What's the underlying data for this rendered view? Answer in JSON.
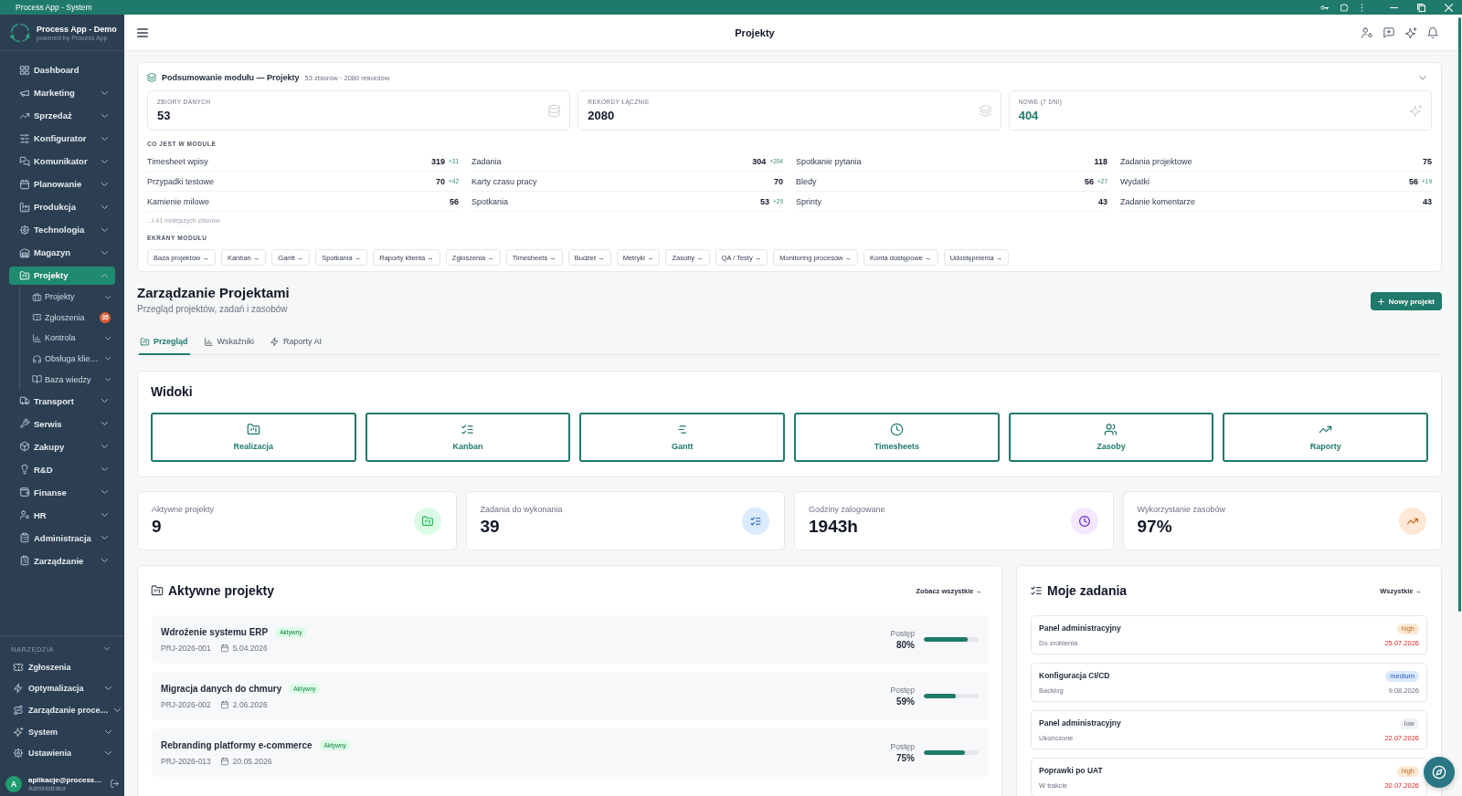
{
  "window": {
    "title": "Process App - System"
  },
  "sidebar": {
    "brand": {
      "name": "Process App - Demo",
      "tagline": "powered by Process App"
    },
    "items": [
      {
        "label": "Dashboard",
        "kind": "link",
        "selected": false
      },
      {
        "label": "Marketing",
        "kind": "group",
        "selected": false,
        "expanded": false
      },
      {
        "label": "Sprzedaż",
        "kind": "group",
        "selected": false,
        "expanded": false
      },
      {
        "label": "Konfigurator",
        "kind": "group",
        "selected": false,
        "expanded": false
      },
      {
        "label": "Komunikator",
        "kind": "group",
        "selected": false,
        "expanded": false
      },
      {
        "label": "Planowanie",
        "kind": "group",
        "selected": false,
        "expanded": false
      },
      {
        "label": "Produkcja",
        "kind": "group",
        "selected": false,
        "expanded": false
      },
      {
        "label": "Technologia",
        "kind": "group",
        "selected": false,
        "expanded": false
      },
      {
        "label": "Magazyn",
        "kind": "group",
        "selected": false,
        "expanded": false
      },
      {
        "label": "Projekty",
        "kind": "group",
        "selected": true,
        "expanded": true,
        "children": [
          {
            "label": "Projekty",
            "kind": "group",
            "selected": false,
            "expanded": false
          },
          {
            "label": "Zgłoszenia",
            "kind": "link",
            "selected": false,
            "badge": "35"
          },
          {
            "label": "Kontrola",
            "kind": "group",
            "selected": false,
            "expanded": false
          },
          {
            "label": "Obsługa klie…",
            "kind": "group",
            "selected": false,
            "expanded": false
          },
          {
            "label": "Baza wiedzy",
            "kind": "group",
            "selected": false,
            "expanded": false
          }
        ]
      },
      {
        "label": "Transport",
        "kind": "group",
        "selected": false,
        "expanded": false
      },
      {
        "label": "Serwis",
        "kind": "group",
        "selected": false,
        "expanded": false
      },
      {
        "label": "Zakupy",
        "kind": "group",
        "selected": false,
        "expanded": false
      },
      {
        "label": "R&D",
        "kind": "group",
        "selected": false,
        "expanded": false
      },
      {
        "label": "Finanse",
        "kind": "group",
        "selected": false,
        "expanded": false
      },
      {
        "label": "HR",
        "kind": "group",
        "selected": false,
        "expanded": false
      },
      {
        "label": "Administracja",
        "kind": "group",
        "selected": false,
        "expanded": false
      },
      {
        "label": "Zarządzanie",
        "kind": "group",
        "selected": false,
        "expanded": false
      }
    ],
    "tools": {
      "title": "NARZĘDZIA",
      "items": [
        {
          "label": "Zgłoszenia",
          "kind": "link",
          "selected": false
        },
        {
          "label": "Optymalizacja",
          "kind": "group",
          "selected": false,
          "expanded": false
        },
        {
          "label": "Zarządzanie proce…",
          "kind": "group",
          "selected": false,
          "expanded": false
        },
        {
          "label": "System",
          "kind": "group",
          "selected": false,
          "expanded": false
        },
        {
          "label": "Ustawienia",
          "kind": "group",
          "selected": false,
          "expanded": false
        }
      ]
    },
    "user": {
      "initial": "A",
      "name": "aplikacje@process…",
      "role": "Administrator"
    }
  },
  "header": {
    "title": "Projekty"
  },
  "summary": {
    "title": "Podsumowanie modułu — Projekty",
    "meta": "53 zbiorów · 2080 rekordów",
    "stats": [
      {
        "label": "ZBIORY DANYCH",
        "value": "53",
        "highlight": false
      },
      {
        "label": "REKORDY ŁĄCZNIE",
        "value": "2080",
        "highlight": false
      },
      {
        "label": "NOWE (7 DNI)",
        "value": "404",
        "highlight": true
      }
    ],
    "contents_title": "CO JEST W MODULE",
    "datasets": [
      {
        "name": "Timesheet wpisy",
        "count": "319",
        "delta": "+31"
      },
      {
        "name": "Zadania",
        "count": "304",
        "delta": "+204"
      },
      {
        "name": "Spotkanie pytania",
        "count": "118"
      },
      {
        "name": "Zadania projektowe",
        "count": "75"
      },
      {
        "name": "Przypadki testowe",
        "count": "70",
        "delta": "+42"
      },
      {
        "name": "Karty czasu pracy",
        "count": "70"
      },
      {
        "name": "Bledy",
        "count": "56",
        "delta": "+27"
      },
      {
        "name": "Wydatki",
        "count": "56",
        "delta": "+19"
      },
      {
        "name": "Kamienie milowe",
        "count": "56"
      },
      {
        "name": "Spotkania",
        "count": "53",
        "delta": "+29"
      },
      {
        "name": "Sprinty",
        "count": "43"
      },
      {
        "name": "Zadanie komentarze",
        "count": "43"
      }
    ],
    "more": "...i 41 mniejszych zbiorów",
    "screens_title": "EKRANY MODUŁU",
    "screens": [
      "Baza projektów →",
      "Kanban →",
      "Gantt →",
      "Spotkania →",
      "Raporty klienta →",
      "Zgłoszenia →",
      "Timesheets →",
      "Budżet →",
      "Metryki →",
      "Zasoby →",
      "QA / Testy →",
      "Monitoring procesów →",
      "Konta dostępowe →",
      "Udostępnienia →"
    ]
  },
  "page": {
    "title": "Zarządzanie Projektami",
    "subtitle": "Przegląd projektów, zadań i zasobów",
    "primary_button": "Nowy projekt"
  },
  "tabs": [
    {
      "label": "Przegląd",
      "selected": true
    },
    {
      "label": "Wskaźniki",
      "selected": false
    },
    {
      "label": "Raporty AI",
      "selected": false
    }
  ],
  "views": {
    "title": "Widoki",
    "items": [
      "Realizacja",
      "Kanban",
      "Gantt",
      "Timesheets",
      "Zasoby",
      "Raporty"
    ]
  },
  "kpis": [
    {
      "label": "Aktywne projekty",
      "value": "9",
      "color": "#dcfce7"
    },
    {
      "label": "Zadania do wykonania",
      "value": "39",
      "color": "#dbeafe"
    },
    {
      "label": "Godziny zalogowane",
      "value": "1943h",
      "color": "#f3e8ff"
    },
    {
      "label": "Wykorzystanie zasobów",
      "value": "97%",
      "color": "#ffe8d6"
    }
  ],
  "active_projects": {
    "title": "Aktywne projekty",
    "link": "Zobacz wszystkie →",
    "rows": [
      {
        "name": "Wdrożenie systemu ERP",
        "status": "Aktywny",
        "code": "PRJ-2026-001",
        "date": "5.04.2026",
        "progress_label": "Postęp",
        "progress": "80%",
        "level": 0.8
      },
      {
        "name": "Migracja danych do chmury",
        "status": "Aktywny",
        "code": "PRJ-2026-002",
        "date": "2.06.2026",
        "progress_label": "Postęp",
        "progress": "59%",
        "level": 0.59
      },
      {
        "name": "Rebranding platformy e-commerce",
        "status": "Aktywny",
        "code": "PRJ-2026-013",
        "date": "20.05.2026",
        "progress_label": "Postęp",
        "progress": "75%",
        "level": 0.75
      }
    ]
  },
  "my_tasks": {
    "title": "Moje zadania",
    "link": "Wszystkie →",
    "items": [
      {
        "title": "Panel administracyjny",
        "status": "Do zrobienia",
        "priority": "high",
        "color": "#fde8d4",
        "date": "25.07.2026",
        "overdue": true
      },
      {
        "title": "Konfiguracja CI/CD",
        "status": "Backlog",
        "priority": "medium",
        "color": "#dbe8fc",
        "date": "9.08.2026",
        "overdue": false
      },
      {
        "title": "Panel administracyjny",
        "status": "Ukończone",
        "priority": "low",
        "color": "#f1f2f4",
        "date": "22.07.2026",
        "overdue": true
      },
      {
        "title": "Poprawki po UAT",
        "status": "W trakcie",
        "priority": "high",
        "color": "#fde8d4",
        "date": "20.07.2026",
        "overdue": true
      }
    ]
  }
}
